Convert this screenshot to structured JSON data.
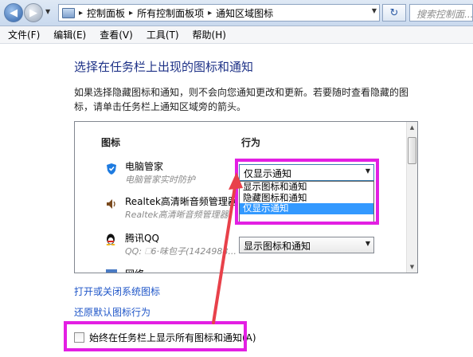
{
  "address": {
    "crumbs": [
      "控制面板",
      "所有控制面板项",
      "通知区域图标"
    ],
    "search_placeholder": "搜索控制面..."
  },
  "menu": [
    "文件(F)",
    "编辑(E)",
    "查看(V)",
    "工具(T)",
    "帮助(H)"
  ],
  "page": {
    "title": "选择在任务栏上出现的图标和通知",
    "description": "如果选择隐藏图标和通知，则不会向您通知更改和更新。若要随时查看隐藏的图标，请单击任务栏上通知区域旁的箭头。"
  },
  "table": {
    "headers": {
      "icon": "图标",
      "behavior": "行为"
    },
    "rows": [
      {
        "name": "电脑管家",
        "sub": "电脑管家实时防护",
        "icon": "shield-icon",
        "value": "仅显示通知"
      },
      {
        "name": "Realtek高清晰音频管理器",
        "sub": "Realtek高清晰音频管理器",
        "icon": "speaker-icon",
        "value": ""
      },
      {
        "name": "腾讯QQ",
        "sub": "QQ: 🗆6·味包子(1424988...",
        "icon": "qq-penguin-icon",
        "value": "显示图标和通知"
      },
      {
        "name": "网络",
        "sub": "",
        "icon": "network-icon",
        "value": ""
      }
    ],
    "dropdown_options": [
      "显示图标和通知",
      "隐藏图标和通知",
      "仅显示通知"
    ],
    "dropdown_selected_index": 2
  },
  "links": {
    "system_icons": "打开或关闭系统图标",
    "restore": "还原默认图标行为"
  },
  "checkbox": {
    "label": "始终在任务栏上显示所有图标和通知(A)",
    "checked": false
  },
  "colors": {
    "highlight": "#e31fe3",
    "arrow": "#e8414a",
    "title": "#1e3287",
    "link": "#1f56c8",
    "selection": "#3399ff"
  }
}
